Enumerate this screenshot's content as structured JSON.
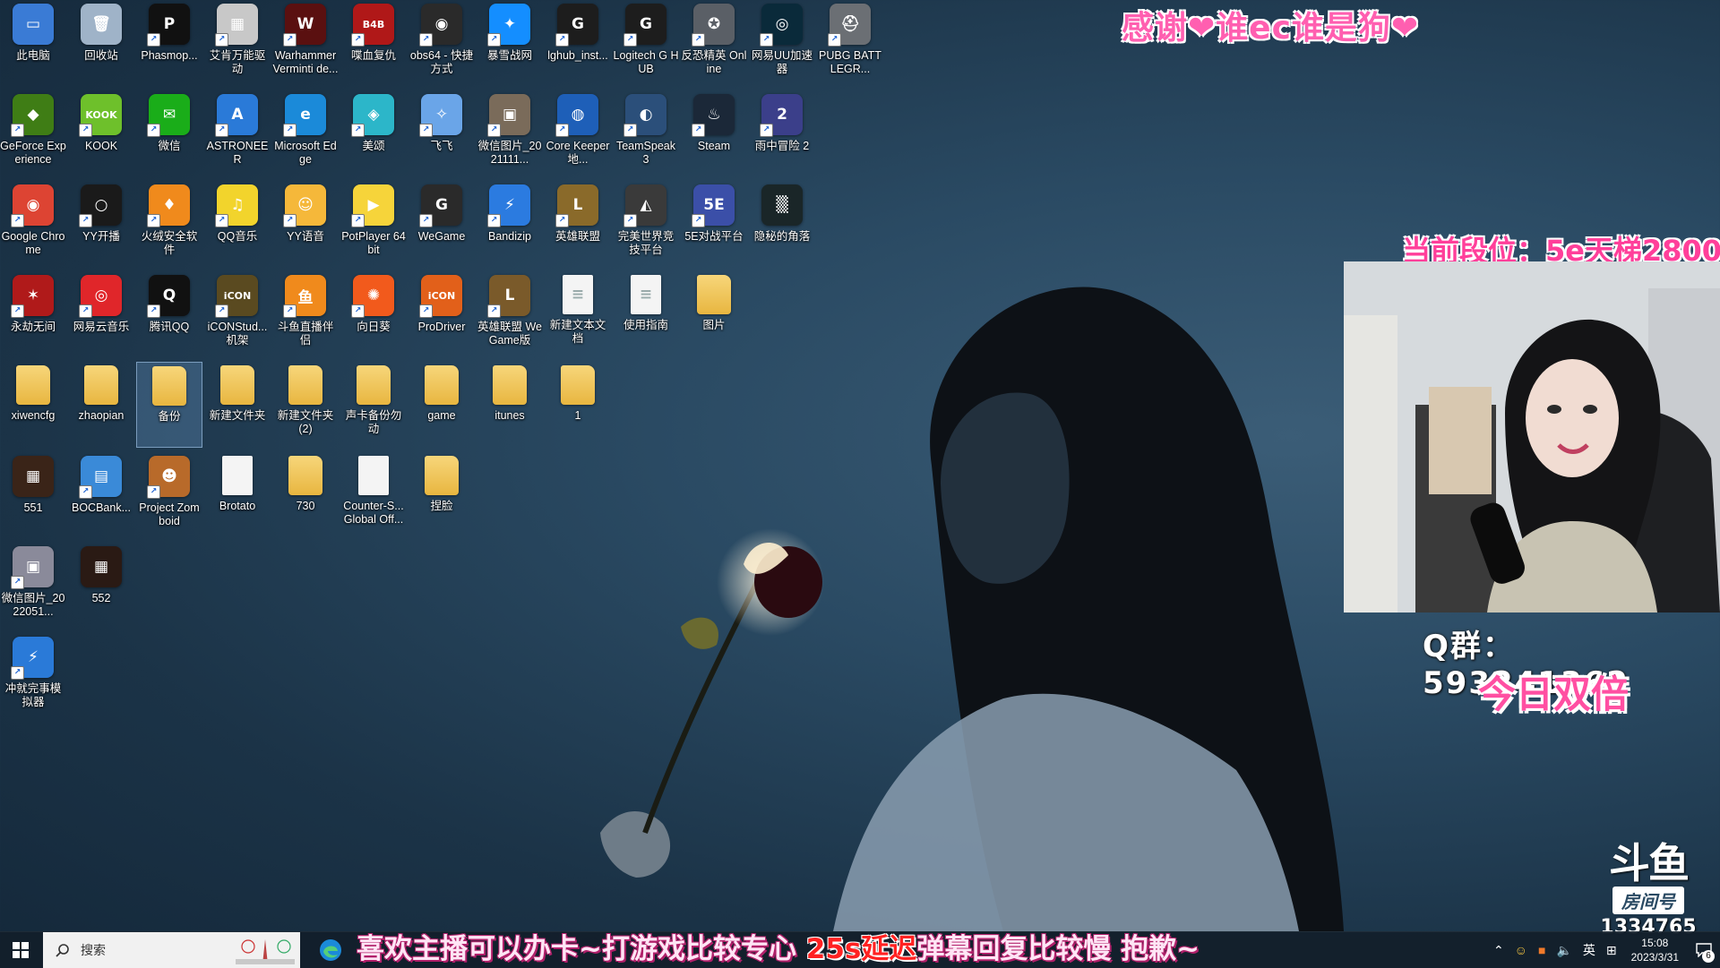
{
  "desktop_icons": [
    {
      "label": "此电脑",
      "bg": "#3a7bd5",
      "glyph": "▭",
      "shortcut": false
    },
    {
      "label": "回收站",
      "bg": "#9fb3c8",
      "glyph": "🗑",
      "shortcut": false
    },
    {
      "label": "Phasmop...",
      "bg": "#111111",
      "glyph": "P",
      "shortcut": true
    },
    {
      "label": "艾肯万能驱动",
      "bg": "#c8c8c8",
      "glyph": "▦",
      "shortcut": true
    },
    {
      "label": "Warhammer Verminti de...",
      "bg": "#5a1010",
      "glyph": "W",
      "shortcut": true
    },
    {
      "label": "喋血复仇",
      "bg": "#b01818",
      "glyph": "B4B",
      "shortcut": true
    },
    {
      "label": "obs64 - 快捷方式",
      "bg": "#2a2a2a",
      "glyph": "◉",
      "shortcut": true
    },
    {
      "label": "暴雪战网",
      "bg": "#148eff",
      "glyph": "✦",
      "shortcut": true
    },
    {
      "label": "lghub_inst...",
      "bg": "#1d1d1d",
      "glyph": "G",
      "shortcut": true
    },
    {
      "label": "Logitech G HUB",
      "bg": "#1d1d1d",
      "glyph": "G",
      "shortcut": true
    },
    {
      "label": "反恐精英 Online",
      "bg": "#5a5f66",
      "glyph": "✪",
      "shortcut": true
    },
    {
      "label": "网易UU加速器",
      "bg": "#0a2a3a",
      "glyph": "◎",
      "shortcut": true
    },
    {
      "label": "PUBG BATTLEGR...",
      "bg": "#6b6f74",
      "glyph": "⛑",
      "shortcut": true
    },
    {
      "label": "GeForce Experience",
      "bg": "#3f7d15",
      "glyph": "◆",
      "shortcut": true
    },
    {
      "label": "KOOK",
      "bg": "#6ec02b",
      "glyph": "KOOK",
      "shortcut": true
    },
    {
      "label": "微信",
      "bg": "#1aad19",
      "glyph": "✉",
      "shortcut": true
    },
    {
      "label": "ASTRONEER",
      "bg": "#2a7ad8",
      "glyph": "A",
      "shortcut": true
    },
    {
      "label": "Microsoft Edge",
      "bg": "#1b8ad9",
      "glyph": "e",
      "shortcut": true
    },
    {
      "label": "美颂",
      "bg": "#2cb6c9",
      "glyph": "◈",
      "shortcut": true
    },
    {
      "label": "飞飞",
      "bg": "#6aa5e8",
      "glyph": "✧",
      "shortcut": true
    },
    {
      "label": "微信图片_2021111...",
      "bg": "#7a6b5a",
      "glyph": "▣",
      "shortcut": true
    },
    {
      "label": "Core Keeper 地...",
      "bg": "#1e5fb8",
      "glyph": "◍",
      "shortcut": true
    },
    {
      "label": "TeamSpeak 3",
      "bg": "#2b4f7a",
      "glyph": "◐",
      "shortcut": true
    },
    {
      "label": "Steam",
      "bg": "#1b2838",
      "glyph": "♨",
      "shortcut": true
    },
    {
      "label": "雨中冒险 2",
      "bg": "#3b3f8a",
      "glyph": "2",
      "shortcut": true
    },
    {
      "label": "Google Chrome",
      "bg": "#dd4433",
      "glyph": "◉",
      "shortcut": true
    },
    {
      "label": "YY开播",
      "bg": "#1a1a1a",
      "glyph": "○",
      "shortcut": true
    },
    {
      "label": "火绒安全软件",
      "bg": "#f08a1c",
      "glyph": "♦",
      "shortcut": true
    },
    {
      "label": "QQ音乐",
      "bg": "#f2d42c",
      "glyph": "♫",
      "shortcut": true
    },
    {
      "label": "YY语音",
      "bg": "#f5b83a",
      "glyph": "☺",
      "shortcut": true
    },
    {
      "label": "PotPlayer 64 bit",
      "bg": "#f6d43a",
      "glyph": "▶",
      "shortcut": true
    },
    {
      "label": "WeGame",
      "bg": "#2a2a2a",
      "glyph": "G",
      "shortcut": true
    },
    {
      "label": "Bandizip",
      "bg": "#2b7be0",
      "glyph": "⚡",
      "shortcut": true
    },
    {
      "label": "英雄联盟",
      "bg": "#8a6a2a",
      "glyph": "L",
      "shortcut": true
    },
    {
      "label": "完美世界竞技平台",
      "bg": "#3a3a3a",
      "glyph": "◭",
      "shortcut": true
    },
    {
      "label": "5E对战平台",
      "bg": "#3b4fa8",
      "glyph": "5E",
      "shortcut": true
    },
    {
      "label": "隐秘的角落",
      "bg": "#1a2628",
      "glyph": "▒",
      "shortcut": false
    },
    {
      "label": "永劫无间",
      "bg": "#b01a1a",
      "glyph": "✶",
      "shortcut": true
    },
    {
      "label": "网易云音乐",
      "bg": "#e0262a",
      "glyph": "◎",
      "shortcut": true
    },
    {
      "label": "腾讯QQ",
      "bg": "#111111",
      "glyph": "Q",
      "shortcut": true
    },
    {
      "label": "iCONStud... 机架",
      "bg": "#5a4a20",
      "glyph": "iCON",
      "shortcut": true
    },
    {
      "label": "斗鱼直播伴侣",
      "bg": "#f08a1c",
      "glyph": "鱼",
      "shortcut": true
    },
    {
      "label": "向日葵",
      "bg": "#f25a1c",
      "glyph": "✺",
      "shortcut": true
    },
    {
      "label": "ProDriver",
      "bg": "#e2601a",
      "glyph": "iCON",
      "shortcut": true
    },
    {
      "label": "英雄联盟 WeGame版",
      "bg": "#7a5a2a",
      "glyph": "L",
      "shortcut": true
    },
    {
      "label": "新建文本文档",
      "bg": "doc",
      "glyph": "≡",
      "shortcut": false
    },
    {
      "label": "使用指南",
      "bg": "doc",
      "glyph": "≡",
      "shortcut": false
    },
    {
      "label": "图片",
      "bg": "folder",
      "glyph": "",
      "shortcut": false
    },
    {
      "label": "xiwencfg",
      "bg": "folder",
      "glyph": "",
      "shortcut": false
    },
    {
      "label": "zhaopian",
      "bg": "folder",
      "glyph": "",
      "shortcut": false
    },
    {
      "label": "备份",
      "bg": "folder",
      "glyph": "",
      "shortcut": false,
      "selected": true
    },
    {
      "label": "新建文件夹",
      "bg": "folder",
      "glyph": "",
      "shortcut": false
    },
    {
      "label": "新建文件夹 (2)",
      "bg": "folder",
      "glyph": "",
      "shortcut": false
    },
    {
      "label": "声卡备份勿动",
      "bg": "folder",
      "glyph": "",
      "shortcut": false
    },
    {
      "label": "game",
      "bg": "folder",
      "glyph": "",
      "shortcut": false
    },
    {
      "label": "itunes",
      "bg": "folder",
      "glyph": "",
      "shortcut": false
    },
    {
      "label": "1",
      "bg": "folder",
      "glyph": "",
      "shortcut": false
    },
    {
      "label": "551",
      "bg": "#3a2418",
      "glyph": "▦",
      "shortcut": false
    },
    {
      "label": "BOCBank...",
      "bg": "#3a8ad8",
      "glyph": "▤",
      "shortcut": true
    },
    {
      "label": "Project Zomboid",
      "bg": "#b86a2a",
      "glyph": "☻",
      "shortcut": true
    },
    {
      "label": "Brotato",
      "bg": "doc",
      "glyph": "",
      "shortcut": false
    },
    {
      "label": "730",
      "bg": "folder",
      "glyph": "",
      "shortcut": false
    },
    {
      "label": "Counter-S... Global Off...",
      "bg": "doc",
      "glyph": "",
      "shortcut": false
    },
    {
      "label": "捏脸",
      "bg": "folder",
      "glyph": "",
      "shortcut": false
    },
    {
      "label": "微信图片_2022051...",
      "bg": "#8a8a9a",
      "glyph": "▣",
      "shortcut": true
    },
    {
      "label": "552",
      "bg": "#2a1a14",
      "glyph": "▦",
      "shortcut": false
    },
    {
      "label": "冲就完事模拟器",
      "bg": "#2a7ad8",
      "glyph": "⚡",
      "shortcut": true
    }
  ],
  "overlay": {
    "top_banner": "感谢❤谁ec谁是狗❤",
    "rank": "当前段位：5e天梯2800",
    "qq_group": "Q群： 593241362",
    "double": "今日双倍",
    "douyu_logo": "斗鱼",
    "douyu_room_label": "房间号",
    "douyu_room_number": "1334765"
  },
  "taskbar": {
    "search_placeholder": "搜索",
    "ticker_part1": "喜欢主播可以办卡~打游戏比较专心 ",
    "ticker_highlight": "25s延迟",
    "ticker_part2": "弹幕回复比较慢 抱歉~",
    "ime_label": "英",
    "time": "15:08",
    "date": "2023/3/31",
    "notification_count": "6"
  },
  "colors": {
    "overlay_pink": "#ff4fa2",
    "taskbar_bg": "#121e2a"
  }
}
